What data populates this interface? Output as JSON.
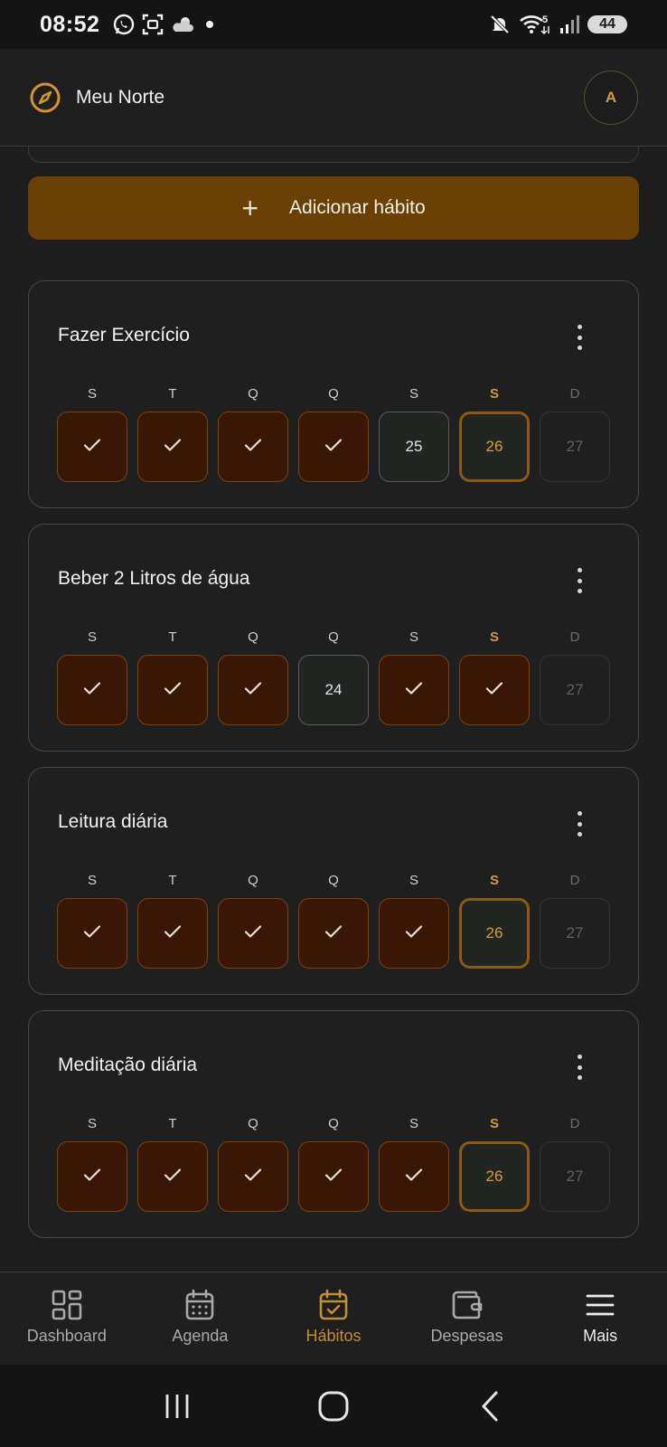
{
  "status_bar": {
    "time": "08:52",
    "battery": "44",
    "network": "5"
  },
  "header": {
    "title": "Meu Norte",
    "avatar_initial": "A"
  },
  "add_habit_label": "Adicionar hábito",
  "weekdays": [
    "S",
    "T",
    "Q",
    "Q",
    "S",
    "S",
    "D"
  ],
  "today_index": 5,
  "habits": [
    {
      "name": "Fazer Exercício",
      "days": [
        {
          "state": "done",
          "text": ""
        },
        {
          "state": "done",
          "text": ""
        },
        {
          "state": "done",
          "text": ""
        },
        {
          "state": "done",
          "text": ""
        },
        {
          "state": "missed",
          "text": "25"
        },
        {
          "state": "today",
          "text": "26"
        },
        {
          "state": "future",
          "text": "27"
        }
      ]
    },
    {
      "name": "Beber 2 Litros de água",
      "days": [
        {
          "state": "done",
          "text": ""
        },
        {
          "state": "done",
          "text": ""
        },
        {
          "state": "done",
          "text": ""
        },
        {
          "state": "missed",
          "text": "24"
        },
        {
          "state": "done",
          "text": ""
        },
        {
          "state": "done",
          "text": ""
        },
        {
          "state": "future",
          "text": "27"
        }
      ]
    },
    {
      "name": "Leitura diária",
      "days": [
        {
          "state": "done",
          "text": ""
        },
        {
          "state": "done",
          "text": ""
        },
        {
          "state": "done",
          "text": ""
        },
        {
          "state": "done",
          "text": ""
        },
        {
          "state": "done",
          "text": ""
        },
        {
          "state": "today",
          "text": "26"
        },
        {
          "state": "future",
          "text": "27"
        }
      ]
    },
    {
      "name": "Meditação diária",
      "days": [
        {
          "state": "done",
          "text": ""
        },
        {
          "state": "done",
          "text": ""
        },
        {
          "state": "done",
          "text": ""
        },
        {
          "state": "done",
          "text": ""
        },
        {
          "state": "done",
          "text": ""
        },
        {
          "state": "today",
          "text": "26"
        },
        {
          "state": "future",
          "text": "27"
        }
      ]
    }
  ],
  "bottom_nav": [
    {
      "label": "Dashboard",
      "icon": "dashboard-grid-icon"
    },
    {
      "label": "Agenda",
      "icon": "calendar-icon"
    },
    {
      "label": "Hábitos",
      "icon": "calendar-check-icon",
      "active": true
    },
    {
      "label": "Despesas",
      "icon": "wallet-icon"
    },
    {
      "label": "Mais",
      "icon": "menu-icon"
    }
  ],
  "colors": {
    "accent": "#c58d34",
    "add_button": "#6a4005",
    "done_fill": "#3a1604",
    "background": "#1d1d1d"
  }
}
